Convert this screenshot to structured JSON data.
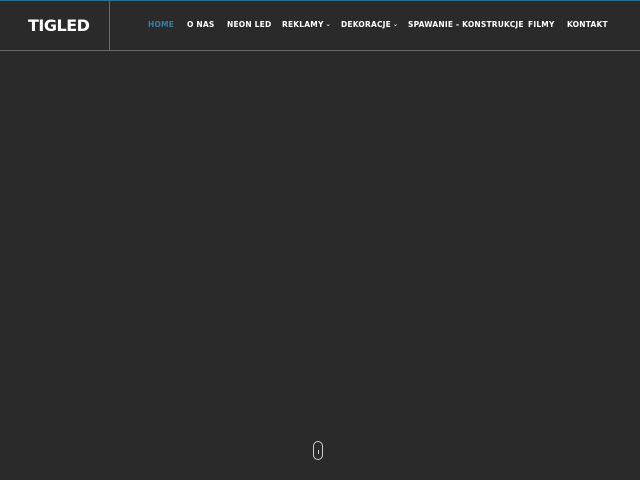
{
  "brand": {
    "logo_text": "TIGLED"
  },
  "nav": {
    "items": [
      {
        "label": "HOME",
        "active": true,
        "has_dropdown": false
      },
      {
        "label": "O NAS",
        "active": false,
        "has_dropdown": false
      },
      {
        "label": "NEON LED",
        "active": false,
        "has_dropdown": false
      },
      {
        "label": "REKLAMY",
        "active": false,
        "has_dropdown": true
      },
      {
        "label": "DEKORACJE",
        "active": false,
        "has_dropdown": true
      },
      {
        "label": "SPAWANIE - KONSTRUKCJE",
        "active": false,
        "has_dropdown": false
      },
      {
        "label": "FILMY",
        "active": false,
        "has_dropdown": false
      },
      {
        "label": "KONTAKT",
        "active": false,
        "has_dropdown": false
      }
    ]
  },
  "icons": {
    "dropdown": "chevron-down-icon",
    "scroll": "mouse-scroll-icon"
  },
  "colors": {
    "background": "#2a2a2a",
    "accent": "#3a7fa3",
    "nav_text": "#ffffff",
    "divider": "#6a6a6a"
  }
}
